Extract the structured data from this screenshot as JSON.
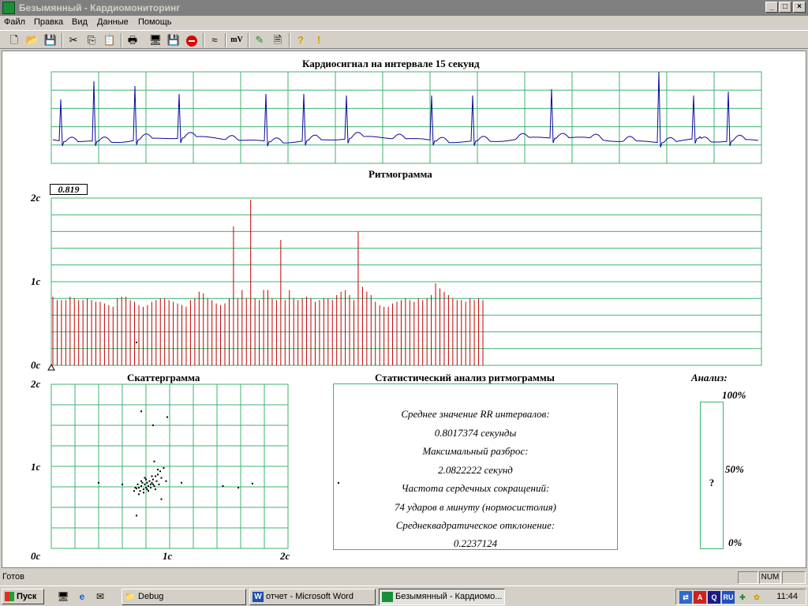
{
  "window": {
    "title": "Безымянный - Кардиомониторинг"
  },
  "menu": [
    "Файл",
    "Правка",
    "Вид",
    "Данные",
    "Помощь"
  ],
  "toolbar": {
    "mv_label": "mV",
    "icons": [
      "new-icon",
      "open-icon",
      "save-icon",
      "cut-icon",
      "copy-icon",
      "paste-icon",
      "print-icon",
      "monitor-icon",
      "save-disk-icon",
      "stop-icon",
      "wave-icon",
      "mv-icon",
      "pen-icon",
      "document-icon",
      "help-icon",
      "whatsthis-icon"
    ]
  },
  "ecg": {
    "title": "Кардиосигнал на интервале 15 секунд"
  },
  "rhythm": {
    "title": "Ритмограмма",
    "cursor_value": "0.819",
    "y_labels": [
      "2с",
      "1с",
      "0с"
    ],
    "ylim": [
      0,
      2
    ],
    "chart_data": {
      "type": "bar",
      "title": "Ритмограмма",
      "ylim": [
        0,
        2
      ],
      "values": [
        0.82,
        0.78,
        0.78,
        0.78,
        0.82,
        0.8,
        0.78,
        0.78,
        0.8,
        0.78,
        0.76,
        0.76,
        0.74,
        0.72,
        0.7,
        0.8,
        0.82,
        0.82,
        0.78,
        0.76,
        0.72,
        0.7,
        0.72,
        0.76,
        0.78,
        0.8,
        0.8,
        0.78,
        0.76,
        0.74,
        0.72,
        0.7,
        0.78,
        0.8,
        0.88,
        0.86,
        0.8,
        0.78,
        0.74,
        0.72,
        0.74,
        0.8,
        1.66,
        0.8,
        0.9,
        0.8,
        1.98,
        0.8,
        0.78,
        0.9,
        0.9,
        0.8,
        0.78,
        1.5,
        0.78,
        0.9,
        0.8,
        0.78,
        0.8,
        0.82,
        0.8,
        0.76,
        0.78,
        0.8,
        0.8,
        0.78,
        0.84,
        0.88,
        0.9,
        0.84,
        0.78,
        1.6,
        0.94,
        0.88,
        0.84,
        0.76,
        0.72,
        0.7,
        0.7,
        0.74,
        0.76,
        0.78,
        0.8,
        0.78,
        0.76,
        0.8,
        0.78,
        0.8,
        0.84,
        0.98,
        0.92,
        0.88,
        0.84,
        0.8,
        0.78,
        0.78,
        0.76,
        0.8,
        0.78,
        0.8,
        0.78
      ]
    }
  },
  "scatter": {
    "title": "Скаттерграмма",
    "y_labels": [
      "2с",
      "1с",
      "0с"
    ],
    "x_labels": [
      "1с",
      "2с"
    ],
    "chart_data": {
      "type": "scatter",
      "title": "Скаттерграмма",
      "xlim": [
        0,
        2
      ],
      "ylim": [
        0,
        2
      ],
      "points": [
        [
          0.76,
          1.67
        ],
        [
          0.98,
          1.6
        ],
        [
          0.86,
          1.5
        ],
        [
          0.87,
          1.06
        ],
        [
          0.4,
          0.8
        ],
        [
          0.6,
          0.78
        ],
        [
          0.72,
          0.4
        ],
        [
          0.93,
          0.6
        ],
        [
          1.1,
          0.8
        ],
        [
          1.45,
          0.76
        ],
        [
          1.58,
          0.74
        ],
        [
          1.7,
          0.79
        ],
        [
          0.7,
          0.7
        ],
        [
          0.72,
          0.73
        ],
        [
          0.74,
          0.74
        ],
        [
          0.75,
          0.7
        ],
        [
          0.76,
          0.76
        ],
        [
          0.78,
          0.72
        ],
        [
          0.79,
          0.78
        ],
        [
          0.8,
          0.74
        ],
        [
          0.81,
          0.8
        ],
        [
          0.82,
          0.76
        ],
        [
          0.83,
          0.82
        ],
        [
          0.84,
          0.78
        ],
        [
          0.85,
          0.8
        ],
        [
          0.86,
          0.84
        ],
        [
          0.87,
          0.76
        ],
        [
          0.88,
          0.88
        ],
        [
          0.9,
          0.9
        ],
        [
          0.92,
          0.94
        ],
        [
          0.95,
          0.98
        ],
        [
          0.73,
          0.78
        ],
        [
          0.77,
          0.8
        ],
        [
          0.8,
          0.84
        ],
        [
          0.85,
          0.88
        ],
        [
          0.89,
          0.82
        ],
        [
          0.91,
          0.78
        ],
        [
          0.88,
          0.72
        ],
        [
          0.82,
          0.7
        ],
        [
          0.78,
          0.68
        ],
        [
          0.74,
          0.66
        ],
        [
          0.71,
          0.74
        ],
        [
          0.79,
          0.86
        ],
        [
          0.84,
          0.74
        ],
        [
          0.76,
          0.82
        ],
        [
          0.81,
          0.72
        ],
        [
          0.86,
          0.78
        ],
        [
          0.93,
          0.86
        ],
        [
          0.97,
          0.82
        ],
        [
          0.9,
          0.96
        ]
      ]
    }
  },
  "stats": {
    "title": "Статистический анализ ритмограммы",
    "mean_label": "Среднее значение RR интервалов:",
    "mean_value": "0.8017374 секунды",
    "max_label": "Максимальный разброс:",
    "max_value": "2.0822222 секунд",
    "hr_label": "Частота сердечных сокращений:",
    "hr_value": "74 ударов в минуту (нормосистолия)",
    "sd_label": "Среднеквадратическое отклонение:",
    "sd_value": "0.2237124"
  },
  "analysis": {
    "title": "Анализ:",
    "p100": "100%",
    "p50": "50%",
    "p0": "0%",
    "result": "?"
  },
  "statusbar": {
    "text": "Готов",
    "num": "NUM"
  },
  "taskbar": {
    "start": "Пуск",
    "tasks": [
      "Debug",
      "отчет - Microsoft Word",
      "Безымянный - Кардиомо..."
    ],
    "clock": "11:44"
  }
}
